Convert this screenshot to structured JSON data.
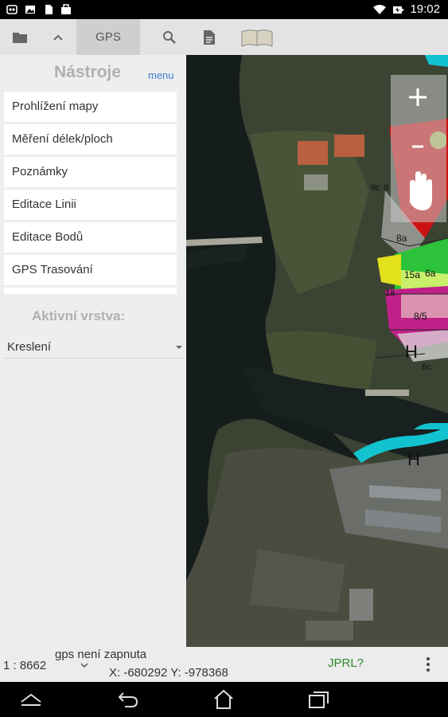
{
  "status_bar": {
    "time": "19:02",
    "icons_left": [
      "app-icon",
      "photo-icon",
      "file-icon",
      "bag-icon"
    ],
    "icons_right": [
      "wifi-icon",
      "battery-charging-icon"
    ]
  },
  "toolbar": {
    "gps_label": "GPS",
    "icons": [
      "folder-icon",
      "chevron-up-icon",
      "search-icon",
      "document-icon",
      "book-icon"
    ]
  },
  "panel": {
    "title": "Nástroje",
    "menu_link": "menu",
    "tools": [
      "Prohlížení mapy",
      "Měření délek/ploch",
      "Poznámky",
      "Editace Linii",
      "Editace Bodů",
      "GPS Trasování"
    ],
    "active_layer_title": "Aktivní vrstva:",
    "active_layer_value": "Kreslení"
  },
  "map": {
    "zoom_in": "+",
    "zoom_out": "-",
    "labels": [
      "H",
      "H",
      "8/5",
      "15a",
      "6a",
      "8a",
      "8c",
      "9",
      "9c",
      "1a"
    ]
  },
  "bottom_bar": {
    "scale": "1 : 8662",
    "gps_status": "gps není zapnuta",
    "coords": "X: -680292 Y: -978368",
    "jprl": "JPRL?"
  }
}
